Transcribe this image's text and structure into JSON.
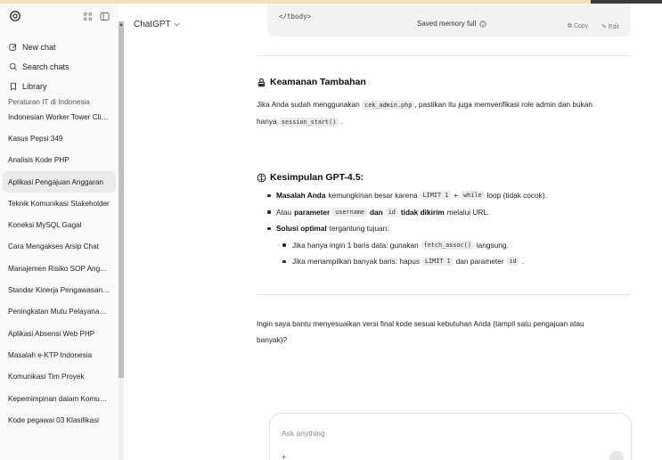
{
  "sidebar": {
    "new_chat": "New chat",
    "search_chats": "Search chats",
    "library": "Library",
    "chats": [
      {
        "label": "Peraturan IT di Indonesia",
        "active": false
      },
      {
        "label": "Indonesian Worker Tower Climb",
        "active": false
      },
      {
        "label": "Kasus Pepsi 349",
        "active": false
      },
      {
        "label": "Analisis Kode PHP",
        "active": false
      },
      {
        "label": "Aplikasi Pengajuan Anggaran",
        "active": true
      },
      {
        "label": "Teknik Komunikasi Stakeholder",
        "active": false
      },
      {
        "label": "Koneksi MySQL Gagal",
        "active": false
      },
      {
        "label": "Cara Mengakses Arsip Chat",
        "active": false
      },
      {
        "label": "Manajemen Risiko SOP Anggar...",
        "active": false
      },
      {
        "label": "Standar Kinerja Pengawasan A...",
        "active": false
      },
      {
        "label": "Peningkatan Mutu Pelayanan R...",
        "active": false
      },
      {
        "label": "Aplikasi Absensi Web PHP",
        "active": false
      },
      {
        "label": "Masalah e-KTP Indonesia",
        "active": false
      },
      {
        "label": "Komunikasi Tim Proyek",
        "active": false
      },
      {
        "label": "Kepemimpinan dalam Komunik...",
        "active": false
      },
      {
        "label": "Kode pegawai 03 Klasifikasi",
        "active": false
      }
    ]
  },
  "header": {
    "model": "ChatGPT"
  },
  "code_block": {
    "tail": "</tbody>",
    "memory": "Saved memory full",
    "copy": "Copy",
    "edit": "Edit"
  },
  "security": {
    "title": "Keamanan Tambahan",
    "p1": "Jika Anda sudah menggunakan",
    "code1": "cek_admin.php",
    "p2": ", pastikan itu juga memverifikasi role admin dan bukan",
    "p3": "hanya",
    "code2": "session_start()",
    "p4": "."
  },
  "conclusion": {
    "title": "Kesimpulan GPT-4.5:",
    "b1_bold": "Masalah Anda",
    "b1_text": "kemungkinan besar karena",
    "b1_code1": "LIMIT 1",
    "b1_plus": "+",
    "b1_code2": "while",
    "b1_tail": "loop (tidak cocok).",
    "b2_pre": "Atau",
    "b2_bold1": "parameter",
    "b2_code1": "username",
    "b2_bold2": "dan",
    "b2_code2": "id",
    "b2_bold3": "tidak dikirim",
    "b2_tail": "melalui URL.",
    "b3_bold": "Solusi optimal",
    "b3_tail": "tergantung tujuan:",
    "s1_pre": "Jika hanya ingin 1 baris data: gunakan",
    "s1_code": "fetch_assoc()",
    "s1_tail": "langsung.",
    "s2_pre": "Jika menampilkan banyak baris: hapus",
    "s2_code1": "LIMIT 1",
    "s2_mid": "dan parameter",
    "s2_code2": "id",
    "s2_tail": "."
  },
  "followup": {
    "line1": "Ingin saya bantu menyesuaikan versi final kode sesuai kebutuhan Anda (tampil satu pengajuan atau",
    "line2": "banyak)?"
  },
  "composer": {
    "placeholder": "Ask anything"
  }
}
